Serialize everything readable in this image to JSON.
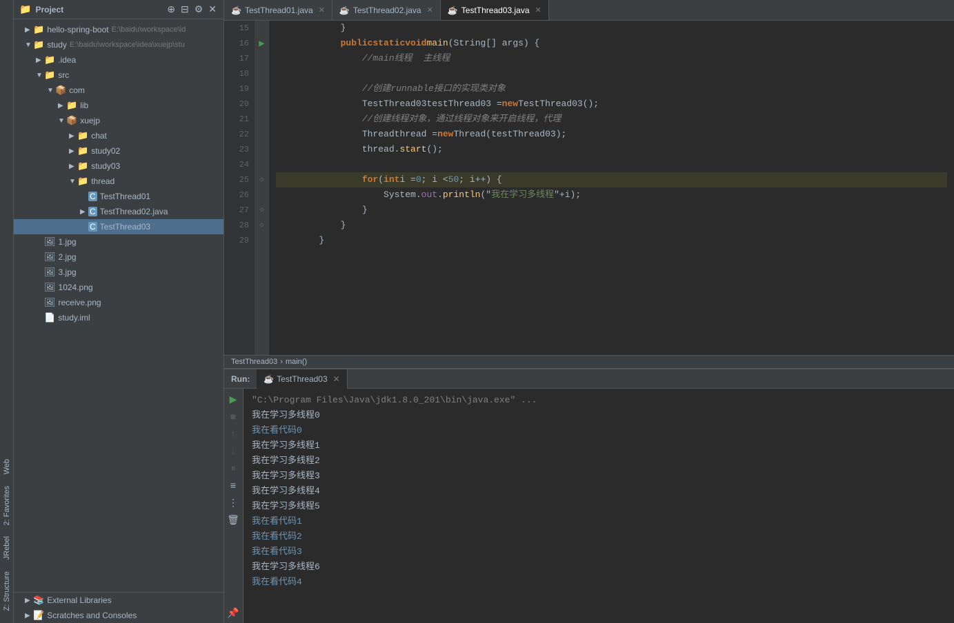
{
  "sidebar": {
    "title": "Project",
    "tree": [
      {
        "id": "hello-spring-boot",
        "label": "hello-spring-boot",
        "path": "E:\\baidu\\workspace\\id",
        "indent": 0,
        "type": "project",
        "expanded": true,
        "arrow": "▶"
      },
      {
        "id": "study",
        "label": "study",
        "path": "E:\\baidu\\workspace\\idea\\xuejp\\stu",
        "indent": 0,
        "type": "project",
        "expanded": true,
        "arrow": "▼"
      },
      {
        "id": "idea",
        "label": ".idea",
        "indent": 1,
        "type": "folder",
        "expanded": false,
        "arrow": "▶"
      },
      {
        "id": "src",
        "label": "src",
        "indent": 1,
        "type": "folder",
        "expanded": true,
        "arrow": "▼"
      },
      {
        "id": "com",
        "label": "com",
        "indent": 2,
        "type": "folder",
        "expanded": true,
        "arrow": "▼"
      },
      {
        "id": "lib",
        "label": "lib",
        "indent": 3,
        "type": "folder",
        "expanded": false,
        "arrow": "▶"
      },
      {
        "id": "xuejp",
        "label": "xuejp",
        "indent": 3,
        "type": "folder",
        "expanded": true,
        "arrow": "▼"
      },
      {
        "id": "chat",
        "label": "chat",
        "indent": 4,
        "type": "folder",
        "expanded": false,
        "arrow": "▶"
      },
      {
        "id": "study02",
        "label": "study02",
        "indent": 4,
        "type": "folder",
        "expanded": false,
        "arrow": "▶"
      },
      {
        "id": "study03",
        "label": "study03",
        "indent": 4,
        "type": "folder",
        "expanded": false,
        "arrow": "▶"
      },
      {
        "id": "thread",
        "label": "thread",
        "indent": 4,
        "type": "folder",
        "expanded": true,
        "arrow": "▼"
      },
      {
        "id": "TestThread01",
        "label": "TestThread01",
        "indent": 5,
        "type": "java",
        "expanded": false,
        "arrow": ""
      },
      {
        "id": "TestThread02",
        "label": "TestThread02.java",
        "indent": 5,
        "type": "java",
        "expanded": false,
        "arrow": "▶"
      },
      {
        "id": "TestThread03",
        "label": "TestThread03",
        "indent": 5,
        "type": "java-selected",
        "expanded": false,
        "arrow": ""
      }
    ],
    "files": [
      {
        "label": "1.jpg",
        "type": "img"
      },
      {
        "label": "2.jpg",
        "type": "img"
      },
      {
        "label": "3.jpg",
        "type": "img"
      },
      {
        "label": "1024.png",
        "type": "img"
      },
      {
        "label": "receive.png",
        "type": "img"
      },
      {
        "label": "study.iml",
        "type": "iml"
      }
    ],
    "footer_items": [
      {
        "label": "External Libraries",
        "icon": "📚"
      },
      {
        "label": "Scratches and Consoles",
        "icon": "📝"
      }
    ]
  },
  "tabs": [
    {
      "label": "TestThread01.java",
      "active": false,
      "modified": false
    },
    {
      "label": "TestThread02.java",
      "active": false,
      "modified": false
    },
    {
      "label": "TestThread03.java",
      "active": true,
      "modified": false
    }
  ],
  "code": {
    "lines": [
      {
        "num": 15,
        "content": "            }",
        "highlight": false
      },
      {
        "num": 16,
        "content": "            public static void main(String[] args) {",
        "highlight": false,
        "hasArrow": true
      },
      {
        "num": 17,
        "content": "                //main线程  主线程",
        "highlight": false
      },
      {
        "num": 18,
        "content": "",
        "highlight": false
      },
      {
        "num": 19,
        "content": "                //创建runnable接口的实现类对象",
        "highlight": false
      },
      {
        "num": 20,
        "content": "                TestThread03 testThread03 = new TestThread03();",
        "highlight": false
      },
      {
        "num": 21,
        "content": "                //创建线程对象，通过线程对象来开启线程，代理",
        "highlight": false
      },
      {
        "num": 22,
        "content": "                Thread thread = new Thread(testThread03);",
        "highlight": false
      },
      {
        "num": 23,
        "content": "                thread.start();",
        "highlight": false
      },
      {
        "num": 24,
        "content": "",
        "highlight": false
      },
      {
        "num": 25,
        "content": "                for (int i = 0; i < 50; i++) {",
        "highlight": true
      },
      {
        "num": 26,
        "content": "                    System.out.println(\"我在学习多线程\"+i);",
        "highlight": false
      },
      {
        "num": 27,
        "content": "                }",
        "highlight": false
      },
      {
        "num": 28,
        "content": "            }",
        "highlight": false
      },
      {
        "num": 29,
        "content": "        }",
        "highlight": false
      }
    ]
  },
  "breadcrumb": {
    "parts": [
      "TestThread03",
      "main()"
    ]
  },
  "run": {
    "label": "Run:",
    "tab_label": "TestThread03",
    "output_lines": [
      {
        "text": "\"C:\\Program Files\\Java\\jdk1.8.0_201\\bin\\java.exe\" ...",
        "type": "cmd"
      },
      {
        "text": "我在学习多线程0",
        "type": "thread1"
      },
      {
        "text": "我在看代码0",
        "type": "thread2"
      },
      {
        "text": "我在学习多线程1",
        "type": "thread1"
      },
      {
        "text": "我在学习多线程2",
        "type": "thread1"
      },
      {
        "text": "我在学习多线程3",
        "type": "thread1"
      },
      {
        "text": "我在学习多线程4",
        "type": "thread1"
      },
      {
        "text": "我在学习多线程5",
        "type": "thread1"
      },
      {
        "text": "我在看代码1",
        "type": "thread2"
      },
      {
        "text": "我在看代码2",
        "type": "thread2"
      },
      {
        "text": "我在看代码3",
        "type": "thread2"
      },
      {
        "text": "我在学习多线程6",
        "type": "thread1"
      },
      {
        "text": "我在看代码4",
        "type": "thread2"
      }
    ]
  },
  "edge_labels": [
    "Z: Structure",
    "JRebel",
    "2: Favorites",
    "Web"
  ]
}
